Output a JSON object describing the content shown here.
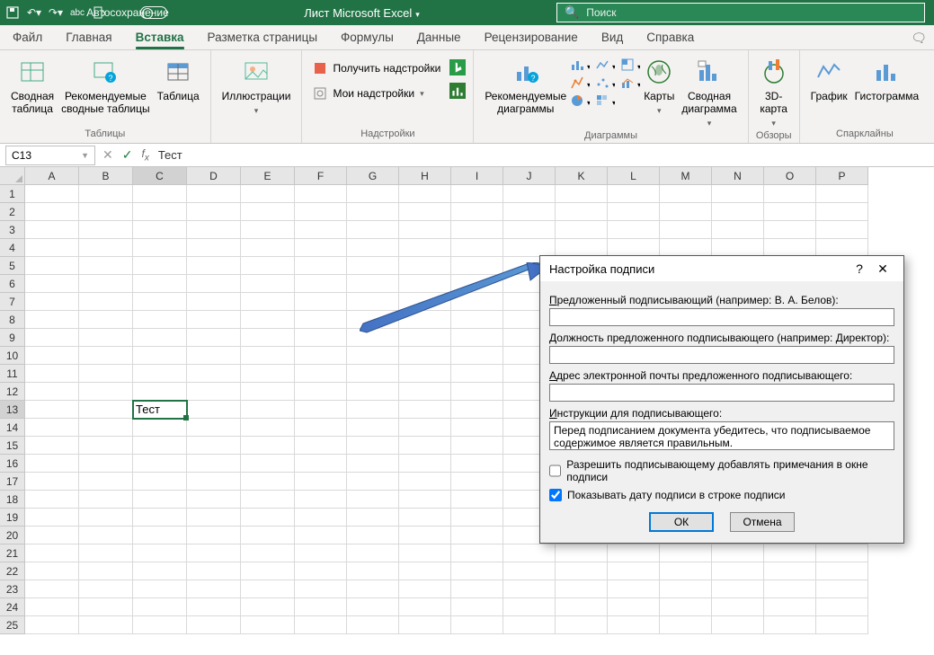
{
  "titlebar": {
    "autosave": "Автосохранение",
    "title": "Лист Microsoft Excel",
    "search": "Поиск"
  },
  "tabs": [
    "Файл",
    "Главная",
    "Вставка",
    "Разметка страницы",
    "Формулы",
    "Данные",
    "Рецензирование",
    "Вид",
    "Справка"
  ],
  "active_tab": 2,
  "ribbon": {
    "g1": {
      "label": "Таблицы",
      "a": "Сводная\nтаблица",
      "b": "Рекомендуемые\nсводные таблицы",
      "c": "Таблица"
    },
    "g2": {
      "label": "",
      "a": "Иллюстрации"
    },
    "g3": {
      "label": "Надстройки",
      "a": "Получить надстройки",
      "b": "Мои надстройки"
    },
    "g4": {
      "label": "Диаграммы",
      "a": "Рекомендуемые\nдиаграммы",
      "b": "Карты",
      "c": "Сводная\nдиаграмма"
    },
    "g5": {
      "label": "Обзоры",
      "a": "3D-\nкарта"
    },
    "g6": {
      "label": "Спарклайны",
      "a": "График",
      "b": "Гистограмма"
    }
  },
  "formula_bar": {
    "name": "C13",
    "value": "Тест"
  },
  "columns": [
    "A",
    "B",
    "C",
    "D",
    "E",
    "F",
    "G",
    "H",
    "I",
    "J",
    "K",
    "L",
    "M",
    "N",
    "O",
    "P"
  ],
  "rows": 25,
  "sel": {
    "r": 13,
    "c": "C",
    "value": "Тест"
  },
  "dialog": {
    "title": "Настройка подписи",
    "l1": "Предложенный подписывающий (например: В. А. Белов):",
    "l2": "Должность предложенного подписывающего (например: Директор):",
    "l3": "Адрес электронной почты предложенного подписывающего:",
    "l4": "Инструкции для подписывающего:",
    "instr": "Перед подписанием документа убедитесь, что подписываемое содержимое является правильным.",
    "chk1": "Разрешить подписывающему добавлять примечания в окне подписи",
    "chk2": "Показывать дату подписи в строке подписи",
    "ok": "ОК",
    "cancel": "Отмена"
  }
}
